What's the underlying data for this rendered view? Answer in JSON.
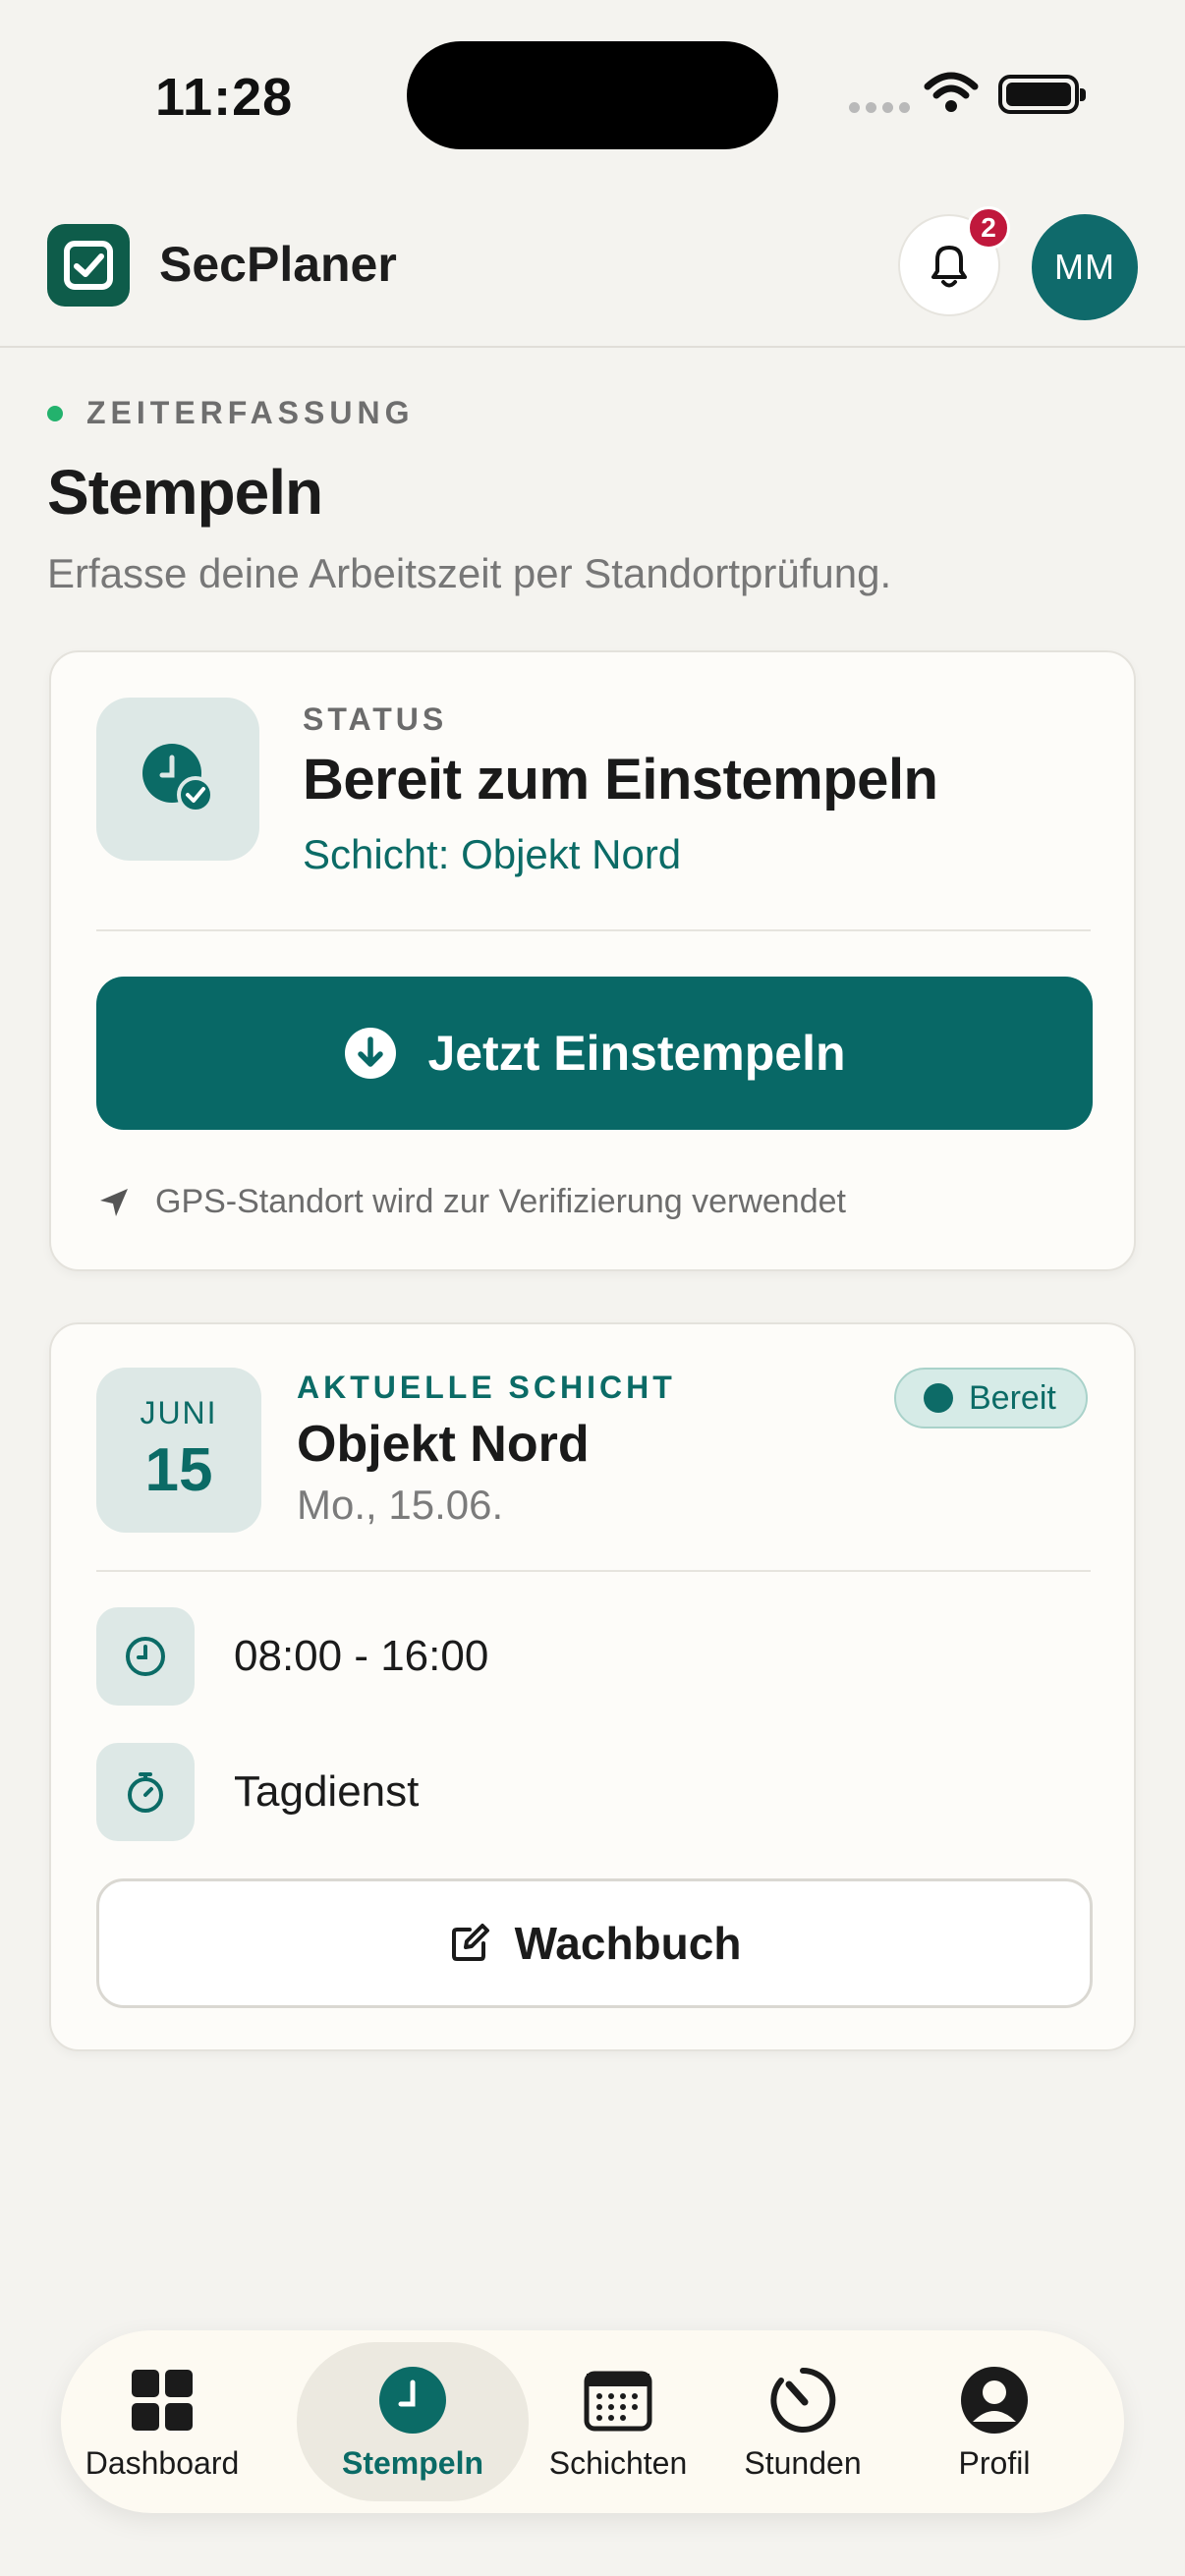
{
  "status_bar": {
    "time": "11:28"
  },
  "header": {
    "app_name": "SecPlaner",
    "notification_count": "2",
    "avatar_initials": "MM"
  },
  "page": {
    "eyebrow": "ZEITERFASSUNG",
    "title": "Stempeln",
    "subtitle": "Erfasse deine Arbeitszeit per Standortprüfung."
  },
  "status_card": {
    "label": "STATUS",
    "value": "Bereit zum Einstempeln",
    "shift": "Schicht: Objekt Nord",
    "button_label": "Jetzt Einstempeln",
    "gps_note": "GPS-Standort wird zur Verifizierung verwendet"
  },
  "shift_card": {
    "month": "JUNI",
    "day": "15",
    "eyebrow": "AKTUELLE SCHICHT",
    "title": "Objekt Nord",
    "date": "Mo., 15.06.",
    "badge": "Bereit",
    "time_range": "08:00 - 16:00",
    "shift_type": "Tagdienst",
    "logbook_label": "Wachbuch"
  },
  "bottom_nav": [
    {
      "label": "Dashboard",
      "icon": "grid-icon"
    },
    {
      "label": "Stempeln",
      "icon": "clock-icon",
      "active": true
    },
    {
      "label": "Schichten",
      "icon": "calendar-icon"
    },
    {
      "label": "Stunden",
      "icon": "timer-icon"
    },
    {
      "label": "Profil",
      "icon": "user-icon"
    }
  ],
  "colors": {
    "accent": "#086866",
    "brand": "#0e5c4a",
    "badge": "#c0183c",
    "background": "#f4f3ef"
  }
}
